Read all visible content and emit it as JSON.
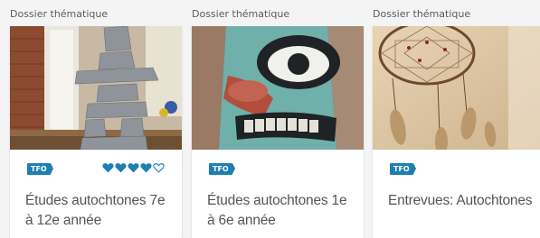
{
  "accent_color": "#1e7fb0",
  "cards": [
    {
      "kicker": "Dossier thématique",
      "badge": "TFO",
      "title": "Études autochtones 7e à 12e année",
      "image": "inukshuk-stone-sculpture",
      "rating": {
        "filled": 4,
        "max": 5
      }
    },
    {
      "kicker": "Dossier thématique",
      "badge": "TFO",
      "title": "Études autochtones 1e à 6e année",
      "image": "totem-pole-face"
    },
    {
      "kicker": "Dossier thématique",
      "badge": "TFO",
      "title": "Entrevues: Autochtones",
      "image": "dreamcatcher"
    }
  ]
}
